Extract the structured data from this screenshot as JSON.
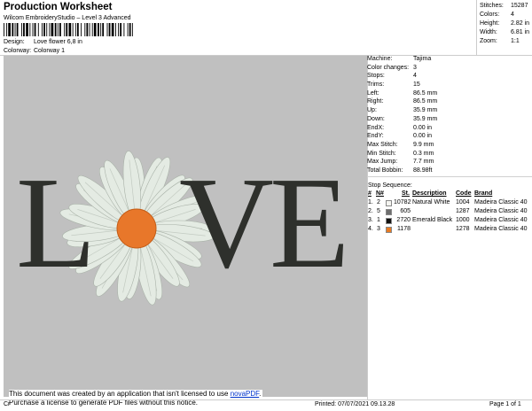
{
  "header": {
    "title": "Production Worksheet",
    "subtitle": "Wilcom EmbroideryStudio – Level 3 Advanced",
    "design_label": "Design:",
    "design_value": "Love flower 6,8 in",
    "colorway_label": "Colorway:",
    "colorway_value": "Colorway 1"
  },
  "stats": [
    {
      "label": "Stitches:",
      "value": "15287"
    },
    {
      "label": "Colors:",
      "value": "4"
    },
    {
      "label": "Height:",
      "value": "2.82 in"
    },
    {
      "label": "Width:",
      "value": "6.81 in"
    },
    {
      "label": "Zoom:",
      "value": "1:1"
    }
  ],
  "preview": {
    "letters": [
      "L",
      "V",
      "E"
    ],
    "letter_color": "#2e302c",
    "petal_color": "#e4ebe3",
    "center_color": "#e8772a"
  },
  "info": [
    {
      "label": "Machine:",
      "value": "Tajima"
    },
    {
      "label": "Color changes:",
      "value": "3"
    },
    {
      "label": "Stops:",
      "value": "4"
    },
    {
      "label": "Trims:",
      "value": "15"
    },
    {
      "label": "Left:",
      "value": "86.5 mm"
    },
    {
      "label": "Right:",
      "value": "86.5 mm"
    },
    {
      "label": "Up:",
      "value": "35.9 mm"
    },
    {
      "label": "Down:",
      "value": "35.9 mm"
    },
    {
      "label": "EndX:",
      "value": "0.00 in"
    },
    {
      "label": "EndY:",
      "value": "0.00 in"
    },
    {
      "label": "Max Stitch:",
      "value": "9.9 mm"
    },
    {
      "label": "Min Stitch:",
      "value": "0.3 mm"
    },
    {
      "label": "Max Jump:",
      "value": "7.7 mm"
    },
    {
      "label": "Total Bobbin:",
      "value": "88.98ft"
    }
  ],
  "stop_sequence": {
    "title": "Stop Sequence:",
    "headers": [
      "#",
      "N#",
      "",
      "St.",
      "Description",
      "Code",
      "Brand"
    ],
    "rows": [
      {
        "idx": "1.",
        "n": "2",
        "color": "#f4f4f0",
        "st": "10782",
        "desc": "Natural White",
        "code": "1004",
        "brand": "Madeira Classic 40"
      },
      {
        "idx": "2.",
        "n": "5",
        "color": "#6e6e6e",
        "st": "605",
        "desc": "",
        "code": "1287",
        "brand": "Madeira Classic 40"
      },
      {
        "idx": "3.",
        "n": "1",
        "color": "#111111",
        "st": "2720",
        "desc": "Emerald Black",
        "code": "1000",
        "brand": "Madeira Classic 40"
      },
      {
        "idx": "4.",
        "n": "3",
        "color": "#e87a22",
        "st": "1178",
        "desc": "",
        "code": "1278",
        "brand": "Madeira Classic 40"
      }
    ]
  },
  "notice": {
    "line1": "This document was created by an application that isn't licensed to use",
    "link": "novaPDF",
    "line1_end": ".",
    "line2": "Purchase a license to generate PDF files without this notice."
  },
  "footer": {
    "left": "Cr",
    "printed": "Printed: 07/07/2021 09.13.28",
    "page": "Page 1 of 1"
  }
}
